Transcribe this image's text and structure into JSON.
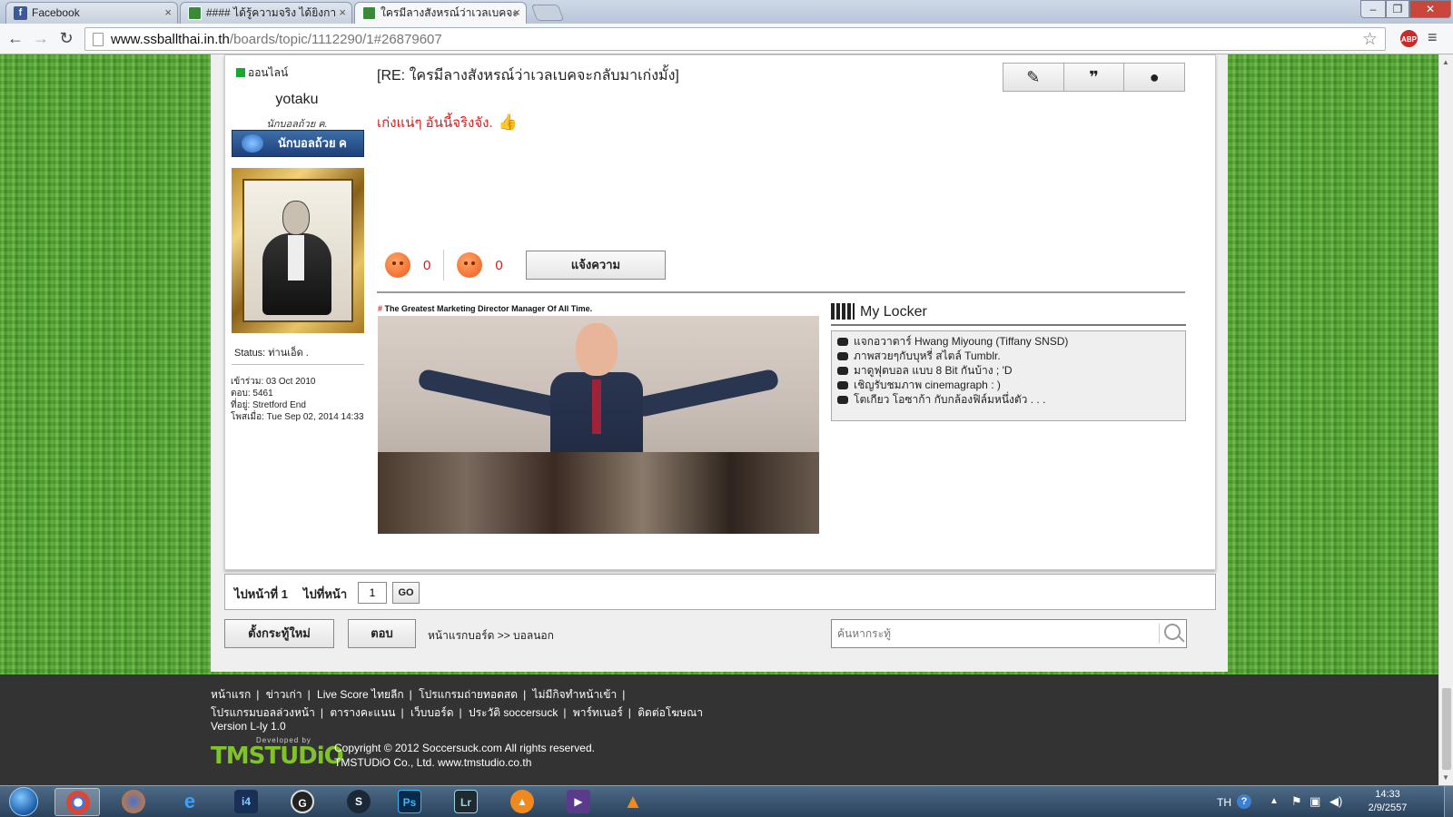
{
  "browser": {
    "tabs": [
      {
        "label": "Facebook",
        "icon": "facebook-icon"
      },
      {
        "label": "#### ได้รู้ความจริง ได้ยิงกา",
        "icon": "site-icon"
      },
      {
        "label": "ใครมีลางสังหรณ์ว่าเวลเบคจะ",
        "icon": "site-icon"
      }
    ],
    "url_domain": "www.ssballthai.in.th",
    "url_path": "/boards/topic/1112290/1#26879607",
    "abp_label": "ABP"
  },
  "post": {
    "online_label": "ออนไลน์",
    "username": "yotaku",
    "rank_text": "นักบอลถ้วย ค.",
    "rank_badge": "นักบอลถ้วย ค",
    "status": "Status: ท่านเอ็ด .",
    "stats": [
      "เข้าร่วม: 03 Oct 2010",
      "ตอบ: 5461",
      "ที่อยู่: Stretford End",
      "โพสเมื่อ: Tue Sep 02, 2014 14:33"
    ],
    "title": "[RE: ใครมีลางสังหรณ์ว่าเวลเบคจะกลับมาเก่งมั้ง]",
    "body": "เก่งแน่ๆ อันนี้จริงจัง.",
    "like_count": "0",
    "dislike_count": "0",
    "report_label": "แจ้งความ",
    "signature_caption": "The Greatest Marketing Director Manager Of All Time.",
    "signature_hash": "#"
  },
  "locker": {
    "title": "My Locker",
    "items": [
      "แจกอวาตาร์ Hwang Miyoung (Tiffany SNSD)",
      "ภาพสวยๆกับบุหรี่ สไตล์ Tumblr.",
      "มาดูฟุตบอล แบบ 8 Bit กันบ้าง ; 'D",
      "เชิญรับชมภาพ cinemagraph : )",
      "โตเกียว โอซาก้า กับกล้องฟิล์มหนึ่งตัว . . ."
    ]
  },
  "pager": {
    "page_label": "ไปหน้าที่ 1",
    "goto_label": "ไปที่หน้า",
    "page_value": "1",
    "go_label": "GO"
  },
  "actions": {
    "new_topic": "ตั้งกระทู้ใหม่",
    "reply": "ตอบ",
    "breadcrumb": "หน้าแรกบอร์ด >> บอลนอก",
    "search_placeholder": "ค้นหากระทู้"
  },
  "footer": {
    "links_row1": [
      "หน้าแรก",
      "ข่าวเก่า",
      "Live Score ไทยลีก",
      "โปรแกรมถ่ายทอดสด",
      "ไม่มีกิจทำหน้าเข้า"
    ],
    "links_row2": [
      "โปรแกรมบอลล่วงหน้า",
      "ตารางคะแนน",
      "เว็บบอร์ด",
      "ประวัติ soccersuck",
      "พาร์ทเนอร์",
      "ติดต่อโฆษณา"
    ],
    "version": "Version L-ly 1.0",
    "logo_dev": "Developed by",
    "logo_brand": "TMSTUDiO",
    "copyright1": "Copyright © 2012 Soccersuck.com All rights reserved.",
    "copyright2": "TMSTUDiO Co., Ltd. www.tmstudio.co.th"
  },
  "taskbar": {
    "language": "TH",
    "time": "14:33",
    "date": "2/9/2557",
    "apps": [
      "chrome",
      "firefox",
      "internet-explorer",
      "i4",
      "gameloader",
      "steam",
      "photoshop",
      "lightroom",
      "avast",
      "movie-maker",
      "vlc"
    ]
  }
}
